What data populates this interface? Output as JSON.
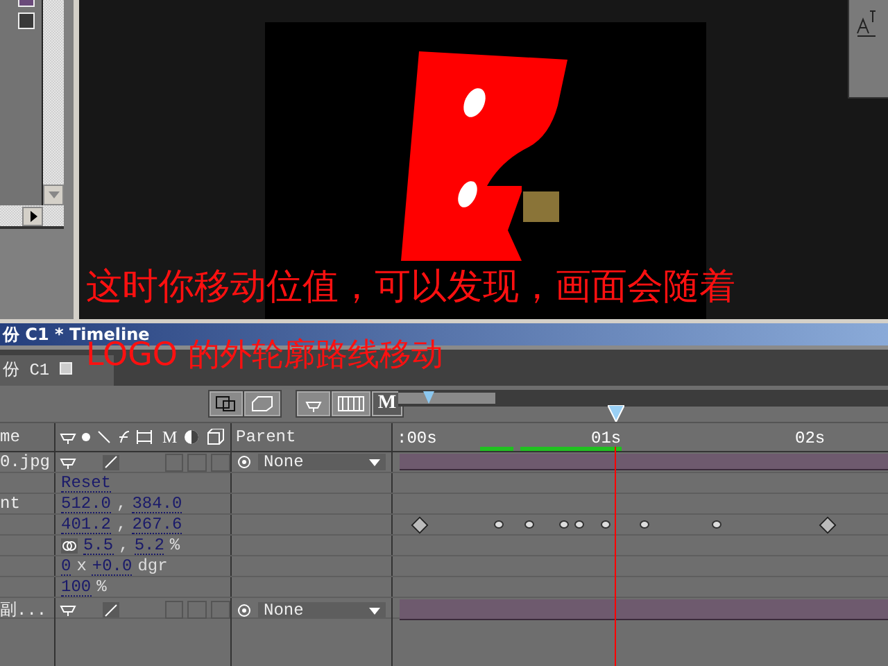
{
  "project_panel": {
    "swatches": [
      {
        "color": "#6a4a7a"
      },
      {
        "color": "#3a3a3a"
      }
    ]
  },
  "subtitle": [
    "这时你移动位值，可以发现，画面会随着",
    "LOGO 的外轮廓路线移动"
  ],
  "timeline": {
    "title": "份 C1 * Timeline",
    "tab": "份 C1",
    "toolbar_letter": "M",
    "switch_letter": "M",
    "name_header": "me",
    "parent_header": "Parent",
    "ruler": [
      ":00s",
      "01s",
      "02s"
    ],
    "rows": [
      {
        "kind": "layer",
        "name": "0.jpg",
        "parent": "None",
        "draft_quality": true
      },
      {
        "kind": "property",
        "segments": [
          {
            "kind": "link",
            "text": "Reset"
          }
        ]
      },
      {
        "kind": "property",
        "name": "nt",
        "segments": [
          {
            "kind": "link",
            "text": "512.0"
          },
          {
            "kind": "plain",
            "text": ","
          },
          {
            "kind": "link",
            "text": "384.0"
          }
        ]
      },
      {
        "kind": "property",
        "segments": [
          {
            "kind": "link",
            "text": "401.2"
          },
          {
            "kind": "plain",
            "text": ","
          },
          {
            "kind": "link",
            "text": "267.6"
          }
        ],
        "keyframes": [
          {
            "kind": "diamond"
          },
          {
            "kind": "dot"
          },
          {
            "kind": "dot"
          },
          {
            "kind": "dot"
          },
          {
            "kind": "dot"
          },
          {
            "kind": "dot"
          },
          {
            "kind": "dot"
          },
          {
            "kind": "dot"
          },
          {
            "kind": "diamond"
          }
        ]
      },
      {
        "kind": "property",
        "linked": true,
        "segments": [
          {
            "kind": "link",
            "text": "5.5"
          },
          {
            "kind": "plain",
            "text": ","
          },
          {
            "kind": "link",
            "text": "5.2"
          },
          {
            "kind": "plain",
            "text": "%"
          }
        ]
      },
      {
        "kind": "property",
        "segments": [
          {
            "kind": "link",
            "text": "0"
          },
          {
            "kind": "plain",
            "text": "x"
          },
          {
            "kind": "link",
            "text": "+0.0"
          },
          {
            "kind": "plain",
            "text": "dgr"
          }
        ]
      },
      {
        "kind": "property",
        "segments": [
          {
            "kind": "link",
            "text": "100"
          },
          {
            "kind": "plain",
            "text": "%"
          }
        ]
      },
      {
        "kind": "layer",
        "name": "副...",
        "parent": "None",
        "draft_quality": true
      }
    ]
  }
}
